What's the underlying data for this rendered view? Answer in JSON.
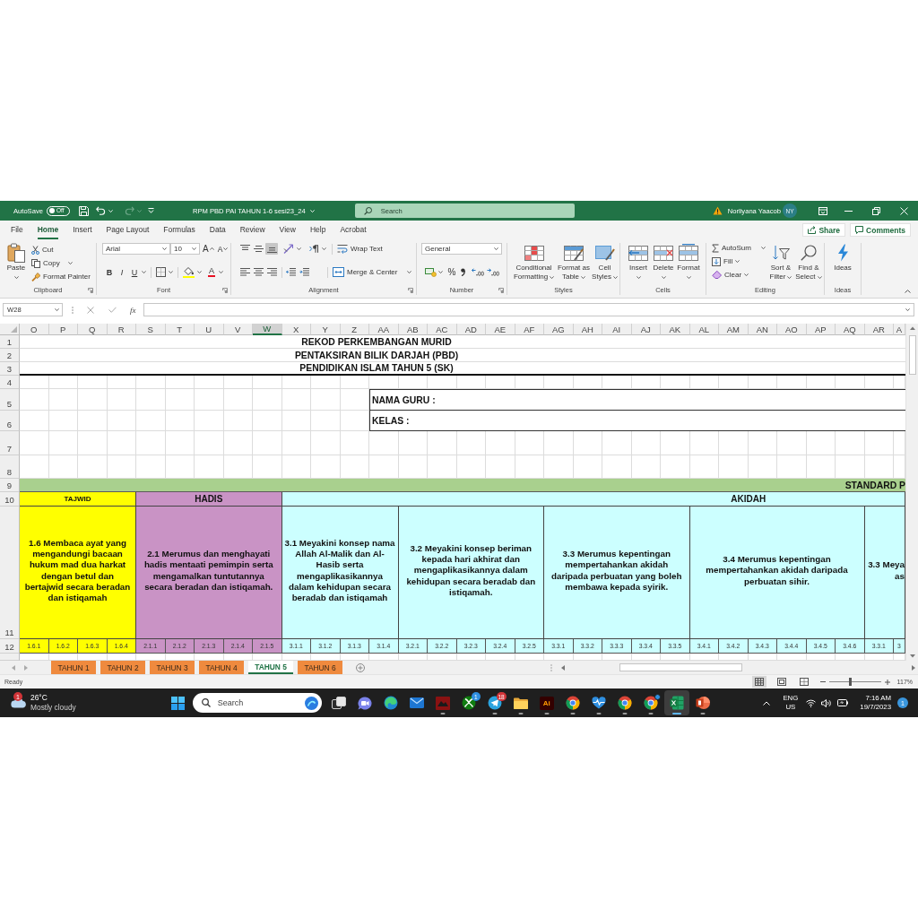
{
  "title_bar": {
    "autosave_label": "AutoSave",
    "autosave_toggle": {
      "label": "Off",
      "on": false
    },
    "file_name": "RPM PBD PAI TAHUN 1-6 sesi23_24",
    "search": {
      "placeholder": "Search"
    },
    "user_name": "Norliyana Yaacob",
    "user_initials": "NY"
  },
  "ribbon_tabs": [
    {
      "label": "File",
      "selected": false
    },
    {
      "label": "Home",
      "selected": true
    },
    {
      "label": "Insert",
      "selected": false
    },
    {
      "label": "Page Layout",
      "selected": false
    },
    {
      "label": "Formulas",
      "selected": false
    },
    {
      "label": "Data",
      "selected": false
    },
    {
      "label": "Review",
      "selected": false
    },
    {
      "label": "View",
      "selected": false
    },
    {
      "label": "Help",
      "selected": false
    },
    {
      "label": "Acrobat",
      "selected": false
    }
  ],
  "share_button": "Share",
  "comments_button": "Comments",
  "ribbon": {
    "clipboard": {
      "label": "Clipboard",
      "paste": "Paste",
      "cut": "Cut",
      "copy": "Copy",
      "format_painter": "Format Painter"
    },
    "font": {
      "label": "Font",
      "font_name": "Arial",
      "font_size": "10",
      "grow": "A",
      "shrink": "A",
      "bold": "B",
      "italic": "I",
      "underline": "U",
      "font_color": "A"
    },
    "alignment": {
      "label": "Alignment",
      "wrap_text": "Wrap Text",
      "merge_center": "Merge & Center",
      "vertical_align": [
        {
          "kind": "top",
          "selected": false
        },
        {
          "kind": "middle",
          "selected": false
        },
        {
          "kind": "bottom",
          "selected": true
        }
      ]
    },
    "number": {
      "label": "Number",
      "format": "General",
      "percent": "%"
    },
    "styles": {
      "label": "Styles",
      "buttons": [
        {
          "kind": "conditional",
          "lines": [
            "Conditional",
            "Formatting"
          ]
        },
        {
          "kind": "table",
          "lines": [
            "Format as",
            "Table"
          ]
        },
        {
          "kind": "cell-styles",
          "lines": [
            "Cell",
            "Styles"
          ]
        }
      ]
    },
    "cells": {
      "label": "Cells",
      "buttons": [
        {
          "kind": "insert",
          "label": "Insert"
        },
        {
          "kind": "delete",
          "label": "Delete"
        },
        {
          "kind": "format",
          "label": "Format"
        }
      ]
    },
    "editing": {
      "label": "Editing",
      "autosum": "AutoSum",
      "fill": "Fill",
      "clear": "Clear",
      "sort_filter": [
        "Sort &",
        "Filter"
      ],
      "find_select": [
        "Find &",
        "Select"
      ]
    },
    "ideas": {
      "label": "Ideas",
      "button": "Ideas"
    }
  },
  "formula_bar": {
    "name_box": "W28",
    "function_label": "fx"
  },
  "sheet": {
    "columns": [
      {
        "label": "O",
        "selected": false
      },
      {
        "label": "P",
        "selected": false
      },
      {
        "label": "Q",
        "selected": false
      },
      {
        "label": "R",
        "selected": false
      },
      {
        "label": "S",
        "selected": false
      },
      {
        "label": "T",
        "selected": false
      },
      {
        "label": "U",
        "selected": false
      },
      {
        "label": "V",
        "selected": false
      },
      {
        "label": "W",
        "selected": true
      },
      {
        "label": "X",
        "selected": false
      },
      {
        "label": "Y",
        "selected": false
      },
      {
        "label": "Z",
        "selected": false
      },
      {
        "label": "AA",
        "selected": false
      },
      {
        "label": "AB",
        "selected": false
      },
      {
        "label": "AC",
        "selected": false
      },
      {
        "label": "AD",
        "selected": false
      },
      {
        "label": "AE",
        "selected": false
      },
      {
        "label": "AF",
        "selected": false
      },
      {
        "label": "AG",
        "selected": false
      },
      {
        "label": "AH",
        "selected": false
      },
      {
        "label": "AI",
        "selected": false
      },
      {
        "label": "AJ",
        "selected": false
      },
      {
        "label": "AK",
        "selected": false
      },
      {
        "label": "AL",
        "selected": false
      },
      {
        "label": "AM",
        "selected": false
      },
      {
        "label": "AN",
        "selected": false
      },
      {
        "label": "AO",
        "selected": false
      },
      {
        "label": "AP",
        "selected": false
      },
      {
        "label": "AQ",
        "selected": false
      },
      {
        "label": "AR",
        "selected": false
      },
      {
        "label": "A",
        "selected": false
      }
    ],
    "row_numbers": [
      "1",
      "2",
      "3",
      "4",
      "5",
      "6",
      "7",
      "8",
      "9",
      "10",
      "11",
      "12"
    ],
    "title_lines": [
      "REKOD PERKEMBANGAN MURID",
      "PENTAKSIRAN BILIK DARJAH (PBD)",
      "PENDIDIKAN ISLAM TAHUN 5 (SK)"
    ],
    "info_fields": [
      "NAMA GURU :",
      "KELAS :"
    ],
    "band_text": "STANDARD P",
    "areas": [
      {
        "name": "TAJWID",
        "kind": "compact",
        "color": "#ffff00",
        "standards": [
          {
            "lines": [
              "1.6 Membaca ayat yang",
              "mengandungi bacaan",
              "hukum mad dua harkat",
              "dengan betul dan",
              "bertajwid secara beradan",
              "dan istiqamah"
            ],
            "codes": [
              "1.6.1",
              "1.6.2",
              "1.6.3",
              "1.6.4"
            ]
          }
        ]
      },
      {
        "name": "HADIS",
        "kind": "standard",
        "color": "#c993c5",
        "standards": [
          {
            "lines": [
              "2.1 Merumus dan menghayati",
              "hadis mentaati pemimpin serta",
              "mengamalkan tuntutannya",
              "secara beradan dan istiqamah."
            ],
            "codes": [
              "2.1.1",
              "2.1.2",
              "2.1.3",
              "2.1.4",
              "2.1.5"
            ]
          }
        ]
      },
      {
        "name": "AKIDAH",
        "kind": "standard",
        "color": "#ccffff",
        "standards": [
          {
            "lines": [
              "3.1 Meyakini konsep nama",
              "Allah Al-Malik dan Al-",
              "Hasib serta",
              "mengaplikasikannya",
              "dalam kehidupan secara",
              "beradab dan istiqamah"
            ],
            "codes": [
              "3.1.1",
              "3.1.2",
              "3.1.3",
              "3.1.4"
            ]
          },
          {
            "lines": [
              "3.2 Meyakini konsep beriman",
              "kepada hari akhirat dan",
              "mengaplikasikannya dalam",
              "kehidupan secara beradab dan",
              "istiqamah."
            ],
            "codes": [
              "3.2.1",
              "3.2.2",
              "3.2.3",
              "3.2.4",
              "3.2.5"
            ]
          },
          {
            "lines": [
              "3.3 Merumus kepentingan",
              "mempertahankan akidah",
              "daripada perbuatan yang boleh",
              "membawa kepada syirik."
            ],
            "codes": [
              "3.3.1",
              "3.3.2",
              "3.3.3",
              "3.3.4",
              "3.3.5"
            ]
          },
          {
            "lines": [
              "3.4 Merumus kepentingan",
              "mempertahankan akidah daripada",
              "perbuatan sihir."
            ],
            "codes": [
              "3.4.1",
              "3.4.2",
              "3.4.3",
              "3.4.4",
              "3.4.5",
              "3.4.6"
            ]
          },
          {
            "lines": [
              "3.3 Meya",
              "as"
            ],
            "codes": [
              "3.3.1",
              "3"
            ]
          }
        ]
      }
    ]
  },
  "sheet_tabs": [
    {
      "label": "TAHUN 1",
      "selected": false
    },
    {
      "label": "TAHUN 2",
      "selected": false
    },
    {
      "label": "TAHUN 3",
      "selected": false
    },
    {
      "label": "TAHUN 4",
      "selected": false
    },
    {
      "label": "TAHUN 5",
      "selected": true
    },
    {
      "label": "TAHUN 6",
      "selected": false
    }
  ],
  "status_bar": {
    "status": "Ready",
    "views": [
      {
        "kind": "normal",
        "selected": true
      },
      {
        "kind": "page-layout",
        "selected": false
      },
      {
        "kind": "page-break",
        "selected": false
      }
    ],
    "zoom": {
      "level": 0.4,
      "reading": "117%"
    }
  },
  "taskbar": {
    "weather": {
      "temperature": "26°C",
      "condition": "Mostly cloudy",
      "badge": "1"
    },
    "search": {
      "placeholder": "Search"
    },
    "apps": [
      {
        "kind": "task-view",
        "running": false,
        "selected": false
      },
      {
        "kind": "video-chat",
        "running": false,
        "selected": false
      },
      {
        "kind": "swirl",
        "running": false,
        "selected": false
      },
      {
        "kind": "envelope",
        "running": false,
        "selected": false
      },
      {
        "kind": "tile",
        "running": true,
        "selected": false
      },
      {
        "kind": "orb",
        "running": false,
        "selected": false,
        "badge": {
          "text": "1",
          "color": "#2f8fe0"
        }
      },
      {
        "kind": "paper-plane",
        "running": true,
        "selected": false,
        "badge": {
          "text": "18",
          "color": "#d13438"
        }
      },
      {
        "kind": "folder",
        "running": true,
        "selected": false
      },
      {
        "kind": "label-tile",
        "label": "Ai",
        "running": true,
        "selected": false
      },
      {
        "kind": "tricolor",
        "running": true,
        "selected": false
      },
      {
        "kind": "heart-pulse",
        "running": true,
        "selected": false
      },
      {
        "kind": "tricolor",
        "running": true,
        "selected": false
      },
      {
        "kind": "tricolor",
        "running": true,
        "selected": false,
        "profile_badge": true
      },
      {
        "kind": "spreadsheet",
        "running": true,
        "selected": true
      },
      {
        "kind": "slides",
        "running": true,
        "selected": false
      }
    ],
    "tray": {
      "language": "ENG",
      "region": "US",
      "time": "7:16 AM",
      "date": "19/7/2023",
      "notifications": "1"
    }
  }
}
